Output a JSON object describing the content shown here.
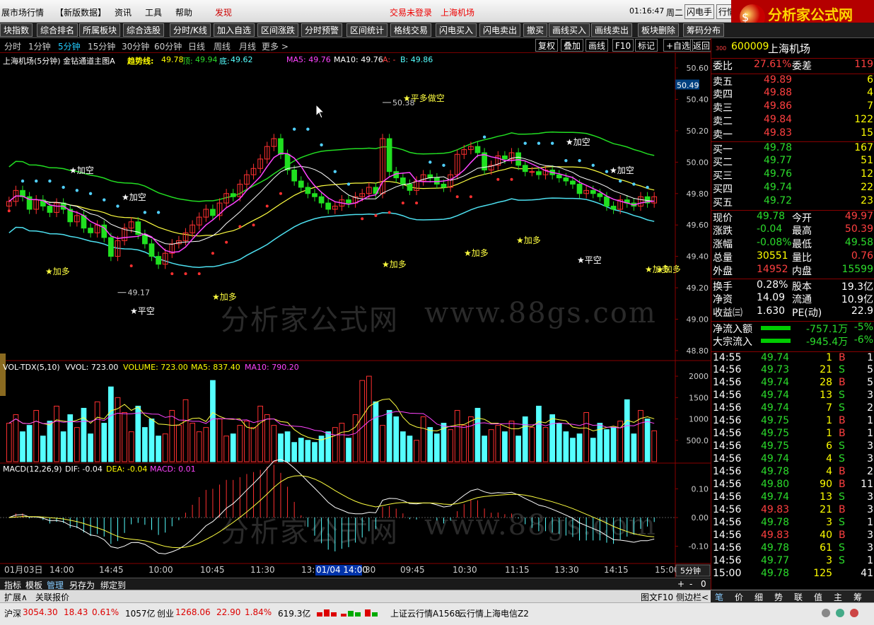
{
  "menu": {
    "items": [
      "展市场行情",
      "【新版数据】",
      "资讯",
      "工具",
      "帮助",
      "发现"
    ],
    "status_login": "交易未登录",
    "status_stock": "上海机场",
    "time": "01:16:47",
    "weekday": "周二",
    "btn_flash": "闪电手",
    "btn_hq": "行情"
  },
  "logo": {
    "title": "分析家公式网",
    "url": "www.88gs.com"
  },
  "toolbar": {
    "buttons": [
      "块指数",
      "综合排名",
      "所属板块",
      "综合选股",
      "分时/K线",
      "加入自选",
      "区间涨跌",
      "分时预警",
      "区间统计",
      "格线交易",
      "闪电买入",
      "闪电卖出",
      "撤买",
      "画线买入",
      "画线卖出",
      "板块删除",
      "筹码分布"
    ]
  },
  "periods": {
    "items": [
      "分时",
      "1分钟",
      "5分钟",
      "15分钟",
      "30分钟",
      "60分钟",
      "日线",
      "周线",
      "月线",
      "更多 >"
    ],
    "active_index": 2,
    "tools": [
      "复权",
      "叠加",
      "画线",
      "F10",
      "标记",
      "+自选",
      "返回"
    ]
  },
  "main_chart": {
    "title": "上海机场(5分钟) 金钻通道主图A",
    "trend_label": "趋势线:",
    "trend_value": "49.78",
    "top_label": "顶:",
    "top_value": "49.94",
    "bottom_label": "底:",
    "bottom_value": "49.62",
    "ma5": "MA5: 49.76",
    "ma10": "MA10: 49.76",
    "a_label": "A: -",
    "b_label": "B: 49.86",
    "price_axis": [
      "50.60",
      "50.40",
      "50.20",
      "50.00",
      "49.80",
      "49.60",
      "49.40",
      "49.20",
      "49.00",
      "48.80"
    ],
    "current_price_tag": "50.49",
    "high_mark": "50.38",
    "low_mark": "49.17",
    "annotations": [
      "★平多做空",
      "★加空",
      "★加空",
      "★加空",
      "★加空",
      "★加多",
      "★加多",
      "★加多",
      "★加多",
      "★加多",
      "★平空",
      "★加多",
      "★平空",
      "★加多"
    ]
  },
  "volume_chart": {
    "title": "VOL-TDX(5,10)",
    "vvol": "VVOL: 723.00",
    "volume": "VOLUME: 723.00",
    "ma5": "MA5: 837.40",
    "ma10": "MA10: 790.20",
    "axis": [
      "2000",
      "1500",
      "1000",
      "500.0"
    ]
  },
  "macd_chart": {
    "title": "MACD(12,26,9)",
    "dif": "DIF: -0.04",
    "dea": "DEA: -0.04",
    "macd": "MACD: 0.01",
    "axis": [
      "0.10",
      "0.00",
      "-0.10"
    ]
  },
  "time_axis": {
    "labels": [
      "01月03日",
      "14:00",
      "14:45",
      "10:00",
      "10:45",
      "11:30",
      "13:",
      "01/04 14:00",
      "30",
      "09:45",
      "10:30",
      "11:15",
      "13:30",
      "14:15",
      "15:00"
    ],
    "period_label": "5分钟"
  },
  "bottom_tabs": {
    "row1": [
      "指标",
      "模板",
      "管理",
      "另存为",
      "绑定到"
    ],
    "row2": [
      "扩展∧",
      "关联报价"
    ],
    "right_buttons": [
      "图文F10",
      "侧边栏<"
    ],
    "side_tabs": [
      "笔",
      "价",
      "细",
      "势",
      "联",
      "值",
      "主",
      "筹"
    ]
  },
  "status_bar": {
    "sh_label": "沪深",
    "sh_value": "3054.30",
    "sh_change": "18.43",
    "sh_pct": "0.61%",
    "sh_amount": "1057亿",
    "cy_label": "创业",
    "cy_value": "1268.06",
    "cy_change": "22.90",
    "cy_pct": "1.84%",
    "cy_amount": "619.3亿",
    "server1": "上证云行情A1568",
    "server2": "云行情上海电信Z2"
  },
  "stock_panel": {
    "market_tag": "300",
    "code": "600009",
    "name": "上海机场",
    "weibi_label": "委比",
    "weibi_value": "27.61%",
    "weicha_label": "委差",
    "weicha_value": "119",
    "sells": [
      {
        "label": "卖五",
        "price": "49.89",
        "vol": "6"
      },
      {
        "label": "卖四",
        "price": "49.88",
        "vol": "4"
      },
      {
        "label": "卖三",
        "price": "49.86",
        "vol": "7"
      },
      {
        "label": "卖二",
        "price": "49.84",
        "vol": "122"
      },
      {
        "label": "卖一",
        "price": "49.83",
        "vol": "15"
      }
    ],
    "buys": [
      {
        "label": "买一",
        "price": "49.78",
        "vol": "167"
      },
      {
        "label": "买二",
        "price": "49.77",
        "vol": "51"
      },
      {
        "label": "买三",
        "price": "49.76",
        "vol": "12"
      },
      {
        "label": "买四",
        "price": "49.74",
        "vol": "22"
      },
      {
        "label": "买五",
        "price": "49.72",
        "vol": "23"
      }
    ],
    "stats": [
      {
        "l1": "现价",
        "v1": "49.78",
        "l2": "今开",
        "v2": "49.97",
        "c1": "green",
        "c2": "red"
      },
      {
        "l1": "涨跌",
        "v1": "-0.04",
        "l2": "最高",
        "v2": "50.39",
        "c1": "green",
        "c2": "red"
      },
      {
        "l1": "涨幅",
        "v1": "-0.08%",
        "l2": "最低",
        "v2": "49.58",
        "c1": "green",
        "c2": "green"
      },
      {
        "l1": "总量",
        "v1": "30551",
        "l2": "量比",
        "v2": "0.76",
        "c1": "yellow",
        "c2": "red"
      },
      {
        "l1": "外盘",
        "v1": "14952",
        "l2": "内盘",
        "v2": "15599",
        "c1": "red",
        "c2": "green"
      }
    ],
    "stats2": [
      {
        "l1": "换手",
        "v1": "0.28%",
        "l2": "股本",
        "v2": "19.3亿"
      },
      {
        "l1": "净资",
        "v1": "14.09",
        "l2": "流通",
        "v2": "10.9亿"
      },
      {
        "l1": "收益㈢",
        "v1": "1.630",
        "l2": "PE(动)",
        "v2": "22.9"
      }
    ],
    "flows": [
      {
        "label": "净流入额",
        "value": "-757.1万",
        "pct": "-5%"
      },
      {
        "label": "大宗流入",
        "value": "-945.4万",
        "pct": "-6%"
      }
    ],
    "ticks": [
      {
        "t": "14:55",
        "p": "49.74",
        "v": "1",
        "d": "B",
        "n": "1",
        "pc": "green",
        "dc": "red"
      },
      {
        "t": "14:56",
        "p": "49.73",
        "v": "21",
        "d": "S",
        "n": "5",
        "pc": "green",
        "dc": "green"
      },
      {
        "t": "14:56",
        "p": "49.74",
        "v": "28",
        "d": "B",
        "n": "5",
        "pc": "green",
        "dc": "red"
      },
      {
        "t": "14:56",
        "p": "49.74",
        "v": "13",
        "d": "S",
        "n": "3",
        "pc": "green",
        "dc": "green"
      },
      {
        "t": "14:56",
        "p": "49.74",
        "v": "7",
        "d": "S",
        "n": "2",
        "pc": "green",
        "dc": "green"
      },
      {
        "t": "14:56",
        "p": "49.75",
        "v": "1",
        "d": "B",
        "n": "1",
        "pc": "green",
        "dc": "red"
      },
      {
        "t": "14:56",
        "p": "49.75",
        "v": "1",
        "d": "B",
        "n": "1",
        "pc": "green",
        "dc": "red"
      },
      {
        "t": "14:56",
        "p": "49.75",
        "v": "6",
        "d": "S",
        "n": "3",
        "pc": "green",
        "dc": "green"
      },
      {
        "t": "14:56",
        "p": "49.74",
        "v": "4",
        "d": "S",
        "n": "3",
        "pc": "green",
        "dc": "green"
      },
      {
        "t": "14:56",
        "p": "49.78",
        "v": "4",
        "d": "B",
        "n": "2",
        "pc": "green",
        "dc": "red"
      },
      {
        "t": "14:56",
        "p": "49.80",
        "v": "90",
        "d": "B",
        "n": "11",
        "pc": "green",
        "dc": "red"
      },
      {
        "t": "14:56",
        "p": "49.74",
        "v": "13",
        "d": "S",
        "n": "3",
        "pc": "green",
        "dc": "green"
      },
      {
        "t": "14:56",
        "p": "49.83",
        "v": "21",
        "d": "B",
        "n": "3",
        "pc": "red",
        "dc": "red"
      },
      {
        "t": "14:56",
        "p": "49.78",
        "v": "3",
        "d": "S",
        "n": "1",
        "pc": "green",
        "dc": "green"
      },
      {
        "t": "14:56",
        "p": "49.83",
        "v": "40",
        "d": "B",
        "n": "3",
        "pc": "red",
        "dc": "red"
      },
      {
        "t": "14:56",
        "p": "49.78",
        "v": "61",
        "d": "S",
        "n": "3",
        "pc": "green",
        "dc": "green"
      },
      {
        "t": "14:56",
        "p": "49.77",
        "v": "3",
        "d": "S",
        "n": "1",
        "pc": "green",
        "dc": "green"
      },
      {
        "t": "15:00",
        "p": "49.78",
        "v": "125",
        "d": "",
        "n": "41",
        "pc": "green",
        "dc": "white"
      }
    ]
  },
  "chart_data": {
    "type": "candlestick",
    "title": "上海机场(5分钟) 金钻通道主图A",
    "ylim": [
      48.75,
      50.65
    ],
    "close": [
      49.75,
      49.82,
      49.78,
      49.7,
      49.76,
      49.72,
      49.68,
      49.74,
      49.7,
      49.62,
      49.66,
      49.58,
      49.55,
      49.6,
      49.52,
      49.4,
      49.5,
      49.58,
      49.62,
      49.54,
      49.48,
      49.4,
      49.35,
      49.42,
      49.48,
      49.5,
      49.55,
      49.6,
      49.65,
      49.7,
      49.66,
      49.74,
      49.8,
      49.78,
      49.86,
      49.92,
      49.96,
      50.02,
      50.1,
      50.15,
      50.05,
      49.95,
      49.88,
      49.84,
      49.8,
      49.78,
      49.74,
      49.7,
      49.72,
      49.76,
      49.74,
      49.78,
      49.8,
      49.84,
      49.8,
      50.15,
      49.94,
      49.9,
      49.86,
      49.82,
      49.88,
      49.92,
      49.9,
      49.86,
      49.84,
      49.92,
      50.05,
      50.08,
      50.1,
      50.06,
      49.95,
      49.98,
      50.04,
      50.02,
      50.06,
      49.98,
      49.94,
      49.94,
      49.92,
      49.95,
      49.92,
      49.9,
      49.88,
      49.86,
      49.8,
      49.82,
      49.8,
      49.78,
      49.72,
      49.7,
      49.76,
      49.74,
      49.72,
      49.78,
      49.74,
      49.78
    ],
    "volume": [
      900,
      1100,
      700,
      850,
      1200,
      600,
      950,
      1300,
      700,
      1100,
      800,
      1250,
      650,
      1400,
      900,
      1750,
      1500,
      1150,
      700,
      1300,
      800,
      1000,
      600,
      650,
      1200,
      850,
      1450,
      900,
      700,
      800,
      1900,
      1000,
      600,
      650,
      850,
      950,
      800,
      1300,
      1100,
      850,
      650,
      700,
      450,
      550,
      500,
      450,
      600,
      700,
      800,
      900,
      550,
      1100,
      1900,
      2000,
      1400,
      850,
      1200,
      1050,
      700,
      600,
      500,
      1050,
      800,
      650,
      900,
      750,
      1200,
      850,
      1050,
      1250,
      600,
      750,
      850,
      700,
      950,
      600,
      1050,
      800,
      1300,
      800,
      1100,
      900,
      700,
      550,
      650,
      1150,
      550,
      900,
      750,
      800,
      950,
      1450,
      650,
      1200,
      1000,
      723
    ],
    "macd_ylim": [
      -0.15,
      0.16
    ]
  }
}
